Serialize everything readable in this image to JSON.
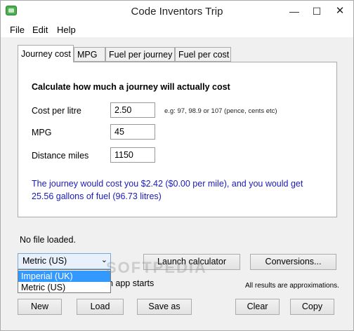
{
  "window": {
    "title": "Code Inventors Trip",
    "minimize": "—",
    "maximize": "☐",
    "close": "✕"
  },
  "menu": {
    "file": "File",
    "edit": "Edit",
    "help": "Help"
  },
  "tabs": [
    "Journey cost",
    "MPG",
    "Fuel per journey",
    "Fuel per cost"
  ],
  "journey": {
    "heading": "Calculate how much a journey will actually cost",
    "cost_label": "Cost per litre",
    "cost_value": "2.50",
    "cost_hint": "e.g: 97, 98.9 or 107 (pence, cents etc)",
    "mpg_label": "MPG",
    "mpg_value": "45",
    "distance_label": "Distance miles",
    "distance_value": "1150",
    "result": "The journey would cost you $2.42 ($0.00 per mile), and you would get 25.56 gallons of fuel (96.73 litres)"
  },
  "status": "No file loaded.",
  "units": {
    "selected": "Metric (US)",
    "options": [
      "Imperial (UK)",
      "Metric (US)"
    ],
    "highlighted": "Imperial (UK)"
  },
  "checkbox_label_visible": "en app starts",
  "note": "All results are approximations.",
  "buttons": {
    "launch": "Launch calculator",
    "conversions": "Conversions...",
    "new": "New",
    "load": "Load",
    "save_as": "Save as",
    "clear": "Clear",
    "copy": "Copy"
  },
  "watermark": "SOFTPEDIA",
  "colors": {
    "result_text": "#1a1ab8",
    "highlight": "#3399ff",
    "app_icon": "#4caf50"
  }
}
